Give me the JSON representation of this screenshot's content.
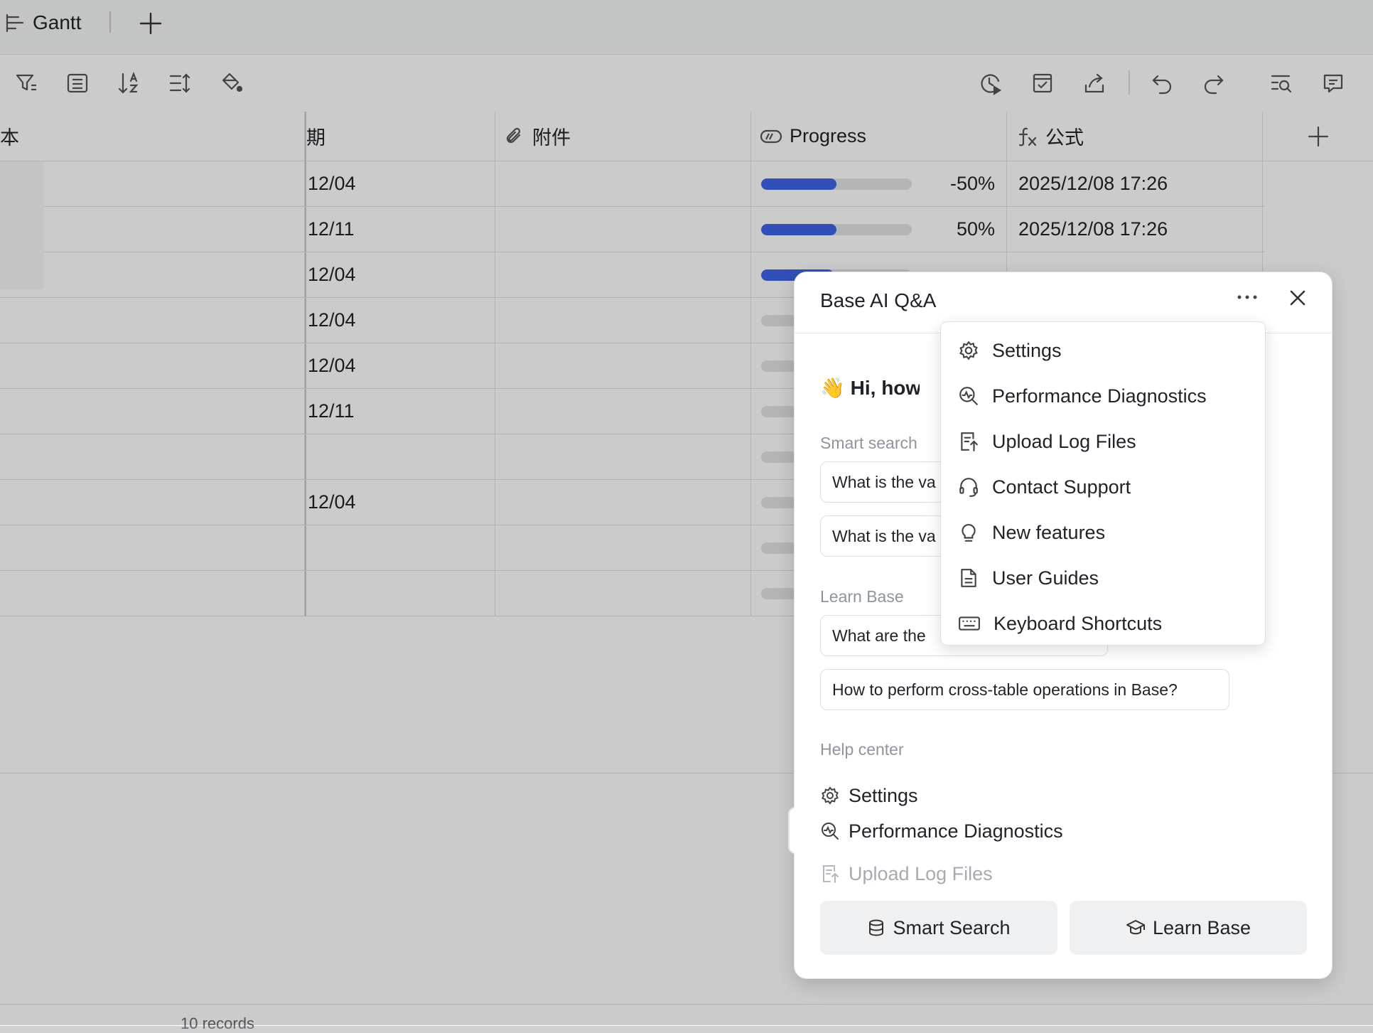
{
  "viewbar": {
    "view_name": "Gantt",
    "add_view_icon": "plus-icon"
  },
  "toolbar": {
    "left_icons": [
      "filter-icon",
      "group-icon",
      "sort-icon",
      "row-height-icon",
      "fill-color-icon"
    ],
    "right_icons": [
      "history-icon",
      "todo-icon",
      "share-icon",
      "undo-icon",
      "redo-icon",
      "search-icon",
      "comment-icon"
    ]
  },
  "grid": {
    "columns": [
      {
        "label": "本",
        "icon": ""
      },
      {
        "label": "期",
        "icon": ""
      },
      {
        "label": "附件",
        "icon": "paperclip-icon"
      },
      {
        "label": "Progress",
        "icon": "progress-icon"
      },
      {
        "label": "公式",
        "icon": "formula-icon"
      }
    ],
    "add_column_icon": "plus-icon",
    "rows": [
      {
        "date": "12/04",
        "progress": -0.5,
        "progress_text": "-50%",
        "formula": "2025/12/08 17:26"
      },
      {
        "date": "12/11",
        "progress": 0.5,
        "progress_text": "50%",
        "formula": "2025/12/08 17:26"
      },
      {
        "date": "12/04",
        "progress": 0.48,
        "progress_text": "",
        "formula": ""
      },
      {
        "date": "12/04",
        "progress": 0,
        "progress_text": "",
        "formula": ""
      },
      {
        "date": "12/04",
        "progress": 0,
        "progress_text": "",
        "formula": ""
      },
      {
        "date": "12/11",
        "progress": 0,
        "progress_text": "",
        "formula": ""
      },
      {
        "date": "",
        "progress": 0,
        "progress_text": "",
        "formula": ""
      },
      {
        "date": "12/04",
        "progress": 0,
        "progress_text": "",
        "formula": ""
      },
      {
        "date": "",
        "progress": 0,
        "progress_text": "",
        "formula": ""
      },
      {
        "date": "",
        "progress": 0,
        "progress_text": "",
        "formula": ""
      }
    ],
    "records_label": "10 records"
  },
  "ai_panel": {
    "title": "Base AI Q&A",
    "greeting": "👋 Hi, how ca",
    "smart_search_label": "Smart search",
    "smart_search_chips": [
      "What is the va",
      "What is the va"
    ],
    "learn_base_label": "Learn Base",
    "learn_base_chips": [
      "What are the",
      "How to perform cross-table operations in Base?"
    ],
    "help_center_label": "Help center",
    "help_items": [
      {
        "label": "Settings",
        "icon": "gear-icon"
      },
      {
        "label": "Performance Diagnostics",
        "icon": "diagnostics-icon"
      },
      {
        "label": "Upload Log Files",
        "icon": "upload-log-icon"
      }
    ],
    "buttons": [
      {
        "label": "Smart Search",
        "icon": "database-icon"
      },
      {
        "label": "Learn Base",
        "icon": "graduation-cap-icon"
      }
    ],
    "more_icon": "ellipsis-icon",
    "close_icon": "close-icon"
  },
  "menu": {
    "items": [
      {
        "label": "Settings",
        "icon": "gear-icon"
      },
      {
        "label": "Performance Diagnostics",
        "icon": "diagnostics-icon",
        "highlighted": true
      },
      {
        "label": "Upload Log Files",
        "icon": "upload-log-icon"
      },
      {
        "label": "Contact Support",
        "icon": "headset-icon"
      },
      {
        "label": "New features",
        "icon": "lightbulb-icon"
      },
      {
        "label": "User Guides",
        "icon": "document-icon"
      },
      {
        "label": "Keyboard Shortcuts",
        "icon": "keyboard-icon"
      }
    ]
  },
  "colors": {
    "progress_fill": "#3e64e6",
    "overlay": "rgba(0,0,0,0.2)"
  }
}
